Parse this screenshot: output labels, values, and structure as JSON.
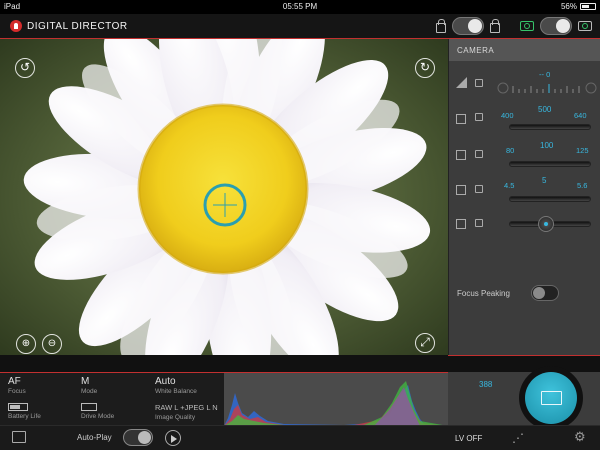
{
  "statusbar": {
    "device": "iPad",
    "time": "05:55 PM",
    "battery": "56%"
  },
  "app": {
    "brand": "DIGITAL DIRECTOR"
  },
  "panel": {
    "header": "CAMERA",
    "exposure_comp": "-- 0",
    "shutter": {
      "low": "400",
      "value": "500",
      "high": "640"
    },
    "iso": {
      "low": "80",
      "value": "100",
      "high": "125"
    },
    "aperture": {
      "low": "4.5",
      "value": "5",
      "high": "5.6"
    },
    "focus_peaking_label": "Focus Peaking"
  },
  "info": {
    "focus": {
      "value": "AF",
      "label": "Focus"
    },
    "mode": {
      "value": "M",
      "label": "Mode"
    },
    "white_balance": {
      "value": "Auto",
      "label": "White Balance"
    },
    "battery_label": "Battery Life",
    "drive_label": "Drive Mode",
    "quality_value": "RAW L +JPEG L N",
    "quality_label": "Image Quality"
  },
  "shots_remaining": "388",
  "bottombar": {
    "autoplay": "Auto-Play",
    "lv": "LV OFF"
  },
  "colors": {
    "accent": "#38b8e0",
    "brand_red": "#c23030",
    "shutter": "#2aa9c4"
  }
}
